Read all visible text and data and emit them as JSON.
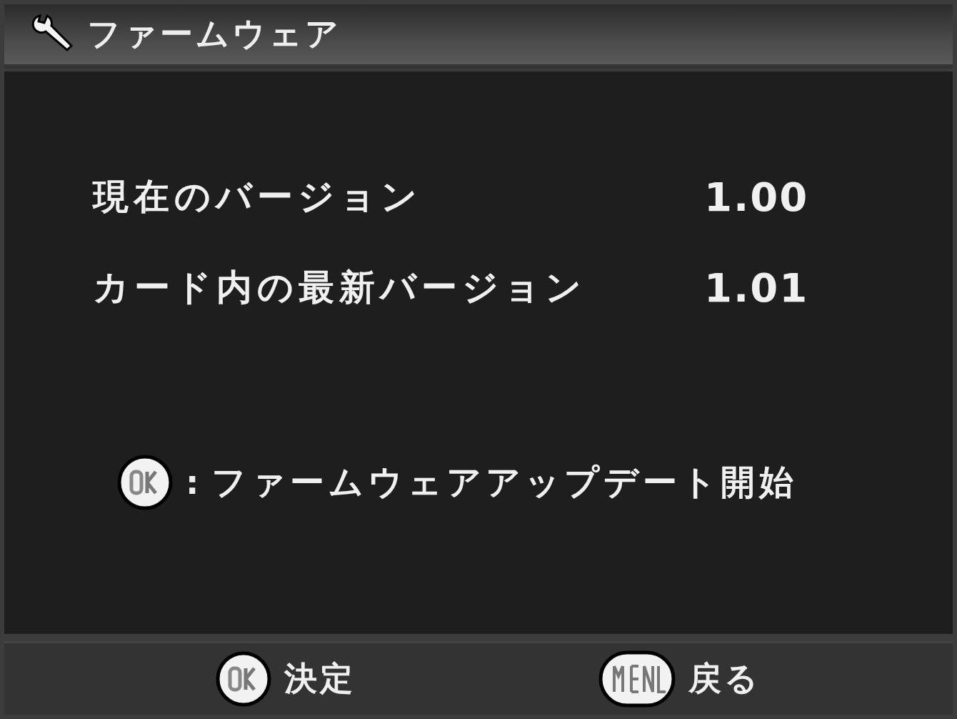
{
  "header": {
    "title": "ファームウェア"
  },
  "rows": [
    {
      "label": "現在のバージョン",
      "value": "1.00"
    },
    {
      "label": "カード内の最新バージョン",
      "value": "1.01"
    }
  ],
  "action": {
    "separator": ":",
    "text": "ファームウェアアップデート開始"
  },
  "footer": [
    {
      "kind": "round",
      "label": "決定"
    },
    {
      "kind": "pill",
      "label": "戻る"
    }
  ]
}
